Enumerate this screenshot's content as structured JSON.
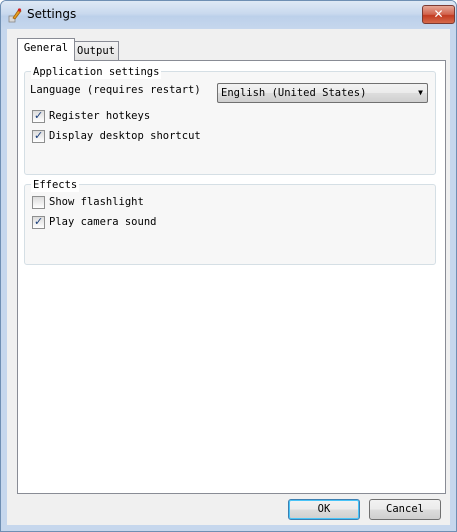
{
  "window": {
    "title": "Settings",
    "close_glyph": "✕"
  },
  "icons": {
    "app": "settings-app-icon",
    "close": "close-icon",
    "dropdown": "chevron-down-icon",
    "check": "checkmark-icon"
  },
  "tabs": [
    {
      "label": "General",
      "active": true
    },
    {
      "label": "Output",
      "active": false
    }
  ],
  "application_settings": {
    "title": "Application settings",
    "language_label": "Language (requires restart)",
    "language_value": "English (United States)",
    "dropdown_glyph": "▼",
    "checkboxes": [
      {
        "label": "Register hotkeys",
        "checked": true
      },
      {
        "label": "Display desktop shortcut",
        "checked": true
      }
    ]
  },
  "effects": {
    "title": "Effects",
    "checkboxes": [
      {
        "label": "Show flashlight",
        "checked": false
      },
      {
        "label": "Play camera sound",
        "checked": true
      }
    ]
  },
  "check_glyph": "✓",
  "buttons": {
    "ok": "OK",
    "cancel": "Cancel"
  }
}
